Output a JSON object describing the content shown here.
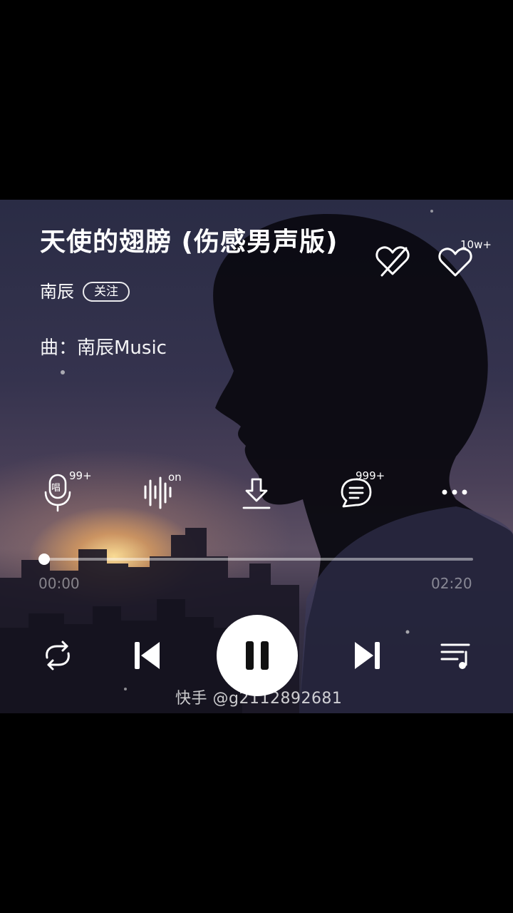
{
  "song": {
    "title": "天使的翅膀 (伤感男声版)",
    "artist": "南辰",
    "follow_label": "关注",
    "composer_label": "曲：南辰Music"
  },
  "top_actions": {
    "like_count": "10w+"
  },
  "actions": {
    "karaoke_count": "99+",
    "karaoke_icon_char": "唱",
    "effect_status": "on",
    "comment_count": "999+"
  },
  "progress": {
    "current_time": "00:00",
    "total_time": "02:20",
    "fraction": 0.0
  },
  "watermark": "快手 @g2112892681",
  "colors": {
    "background": "#000000",
    "foreground": "#ffffff",
    "play_icon": "#111111"
  }
}
